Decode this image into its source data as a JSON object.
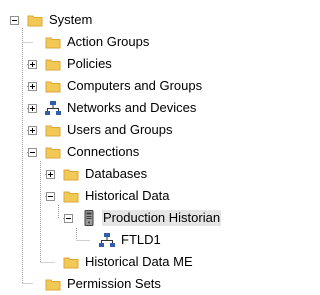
{
  "tree": {
    "items": [
      {
        "label": "System",
        "icon": "folder-icon"
      },
      {
        "label": "Action Groups",
        "icon": "folder-icon"
      },
      {
        "label": "Policies",
        "icon": "folder-icon"
      },
      {
        "label": "Computers and Groups",
        "icon": "folder-icon"
      },
      {
        "label": "Networks and Devices",
        "icon": "network-icon"
      },
      {
        "label": "Users and Groups",
        "icon": "folder-icon"
      },
      {
        "label": "Connections",
        "icon": "folder-icon"
      },
      {
        "label": "Databases",
        "icon": "folder-icon"
      },
      {
        "label": "Historical Data",
        "icon": "folder-icon"
      },
      {
        "label": "Production Historian",
        "icon": "server-icon",
        "selected": true
      },
      {
        "label": "FTLD1",
        "icon": "network-icon"
      },
      {
        "label": "Historical Data ME",
        "icon": "folder-icon"
      },
      {
        "label": "Permission Sets",
        "icon": "folder-icon"
      }
    ]
  },
  "colors": {
    "folder_fill": "#f2c955",
    "folder_tab": "#dca83a",
    "selection": "#e5e5e5",
    "tree_line": "#a0a0a0"
  }
}
